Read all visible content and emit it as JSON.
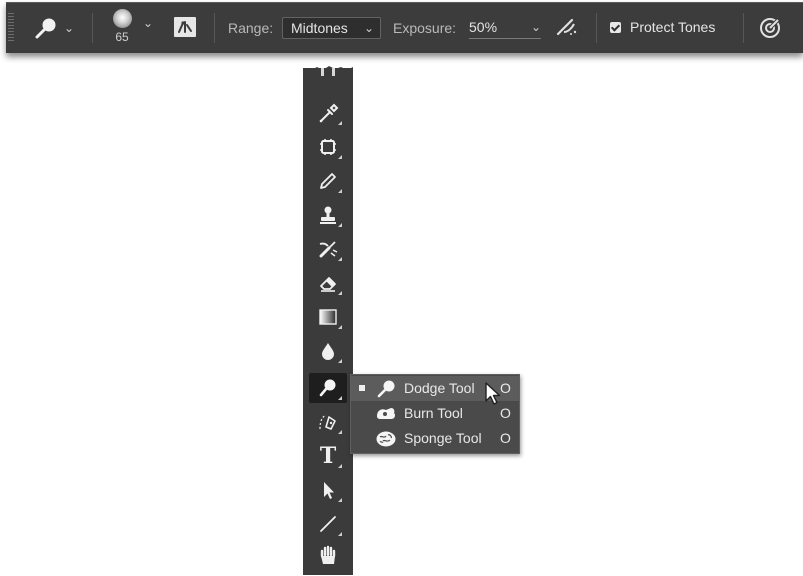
{
  "options_bar": {
    "brush_size": "65",
    "range_label": "Range:",
    "range_value": "Midtones",
    "exposure_label": "Exposure:",
    "exposure_value": "50%",
    "protect_tones_label": "Protect Tones",
    "protect_tones_checked": true,
    "icons": [
      "dodge-tool-icon",
      "chevron-down-icon",
      "brush-preset-icon",
      "brush-settings-panel-icon",
      "airbrush-icon",
      "pressure-size-icon"
    ]
  },
  "toolbar": {
    "tools": [
      {
        "name": "eyedropper-tool"
      },
      {
        "name": "frame-tool"
      },
      {
        "name": "pencil-tool"
      },
      {
        "name": "stamp-tool"
      },
      {
        "name": "history-brush-tool"
      },
      {
        "name": "eraser-tool"
      },
      {
        "name": "gradient-tool"
      },
      {
        "name": "blur-tool"
      },
      {
        "name": "dodge-tool",
        "active": true
      },
      {
        "name": "pen-tool"
      },
      {
        "name": "type-tool"
      },
      {
        "name": "path-selection-tool"
      },
      {
        "name": "line-tool"
      },
      {
        "name": "hand-tool"
      }
    ],
    "type_glyph": "T"
  },
  "flyout": {
    "items": [
      {
        "label": "Dodge Tool",
        "shortcut": "O",
        "selected": true,
        "icon": "dodge-icon"
      },
      {
        "label": "Burn Tool",
        "shortcut": "O",
        "selected": false,
        "icon": "burn-icon"
      },
      {
        "label": "Sponge Tool",
        "shortcut": "O",
        "selected": false,
        "icon": "sponge-icon"
      }
    ]
  }
}
